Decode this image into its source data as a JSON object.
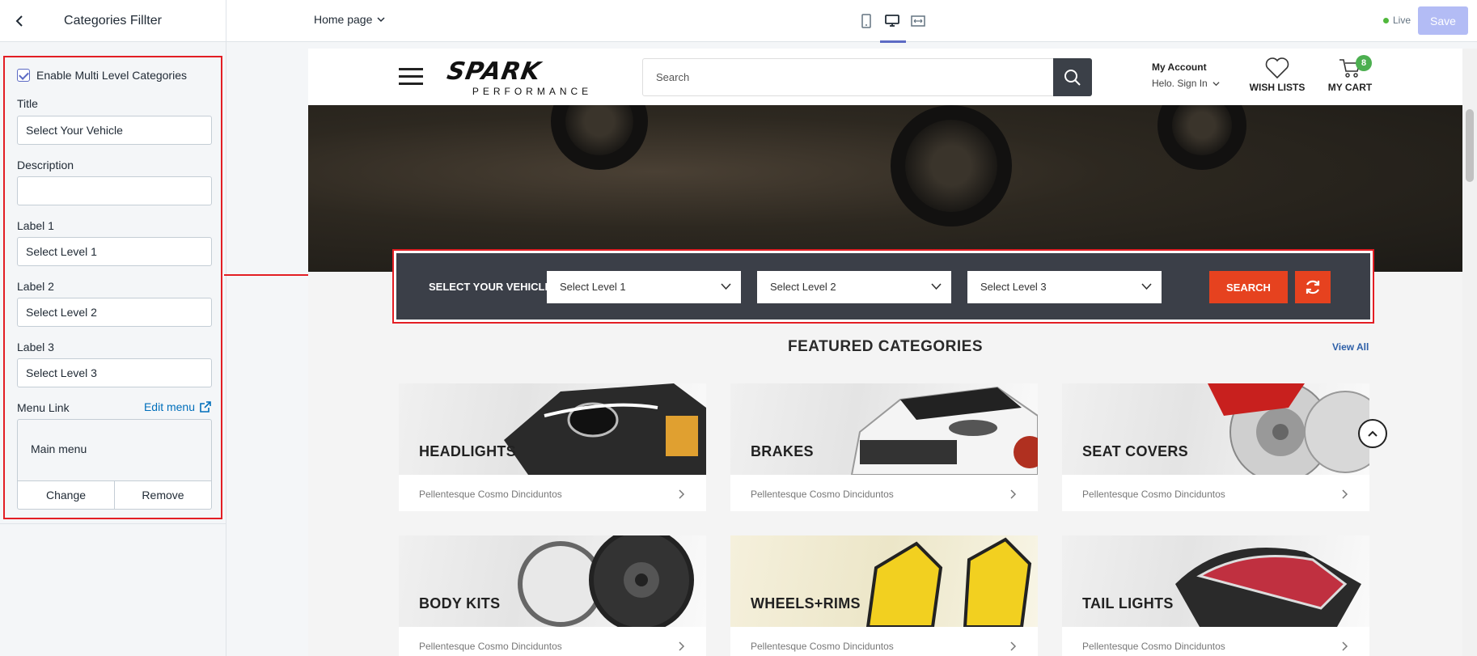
{
  "sidebar": {
    "title": "Categories Fillter",
    "enable_label": "Enable Multi Level Categories",
    "title_label": "Title",
    "title_value": "Select Your Vehicle",
    "description_label": "Description",
    "description_value": "",
    "label1_label": "Label 1",
    "label1_value": "Select Level 1",
    "label2_label": "Label 2",
    "label2_value": "Select Level 2",
    "label3_label": "Label 3",
    "label3_value": "Select Level 3",
    "menu_link_label": "Menu Link",
    "edit_menu_label": "Edit menu",
    "menu_value": "Main menu",
    "change_label": "Change",
    "remove_label": "Remove"
  },
  "topbar": {
    "page_select": "Home page",
    "live_label": "Live",
    "save_label": "Save"
  },
  "site": {
    "logo_main": "SPARK",
    "logo_sub": "PERFORMANCE",
    "search_placeholder": "Search",
    "account_title": "My Account",
    "account_sub": "Helo. Sign In",
    "wishlist_label": "WISH LISTS",
    "cart_label": "MY CART",
    "cart_count": "8"
  },
  "finder": {
    "title": "SELECT YOUR VEHICLE",
    "level1": "Select Level 1",
    "level2": "Select Level 2",
    "level3": "Select Level 3",
    "search_label": "SEARCH"
  },
  "featured": {
    "title": "FEATURED CATEGORIES",
    "view_all": "View All",
    "cards": [
      {
        "name": "HEADLIGHTS",
        "sub": "Pellentesque Cosmo Dinciduntos"
      },
      {
        "name": "BRAKES",
        "sub": "Pellentesque Cosmo Dinciduntos"
      },
      {
        "name": "SEAT COVERS",
        "sub": "Pellentesque Cosmo Dinciduntos"
      },
      {
        "name": "BODY KITS",
        "sub": "Pellentesque Cosmo Dinciduntos"
      },
      {
        "name": "WHEELS+RIMS",
        "sub": "Pellentesque Cosmo Dinciduntos"
      },
      {
        "name": "TAIL LIGHTS",
        "sub": "Pellentesque Cosmo Dinciduntos"
      }
    ]
  },
  "colors": {
    "accent": "#e6421f",
    "annotation": "#e31e24",
    "finder_bg": "#3b3f48",
    "primary": "#5c6ac4"
  }
}
